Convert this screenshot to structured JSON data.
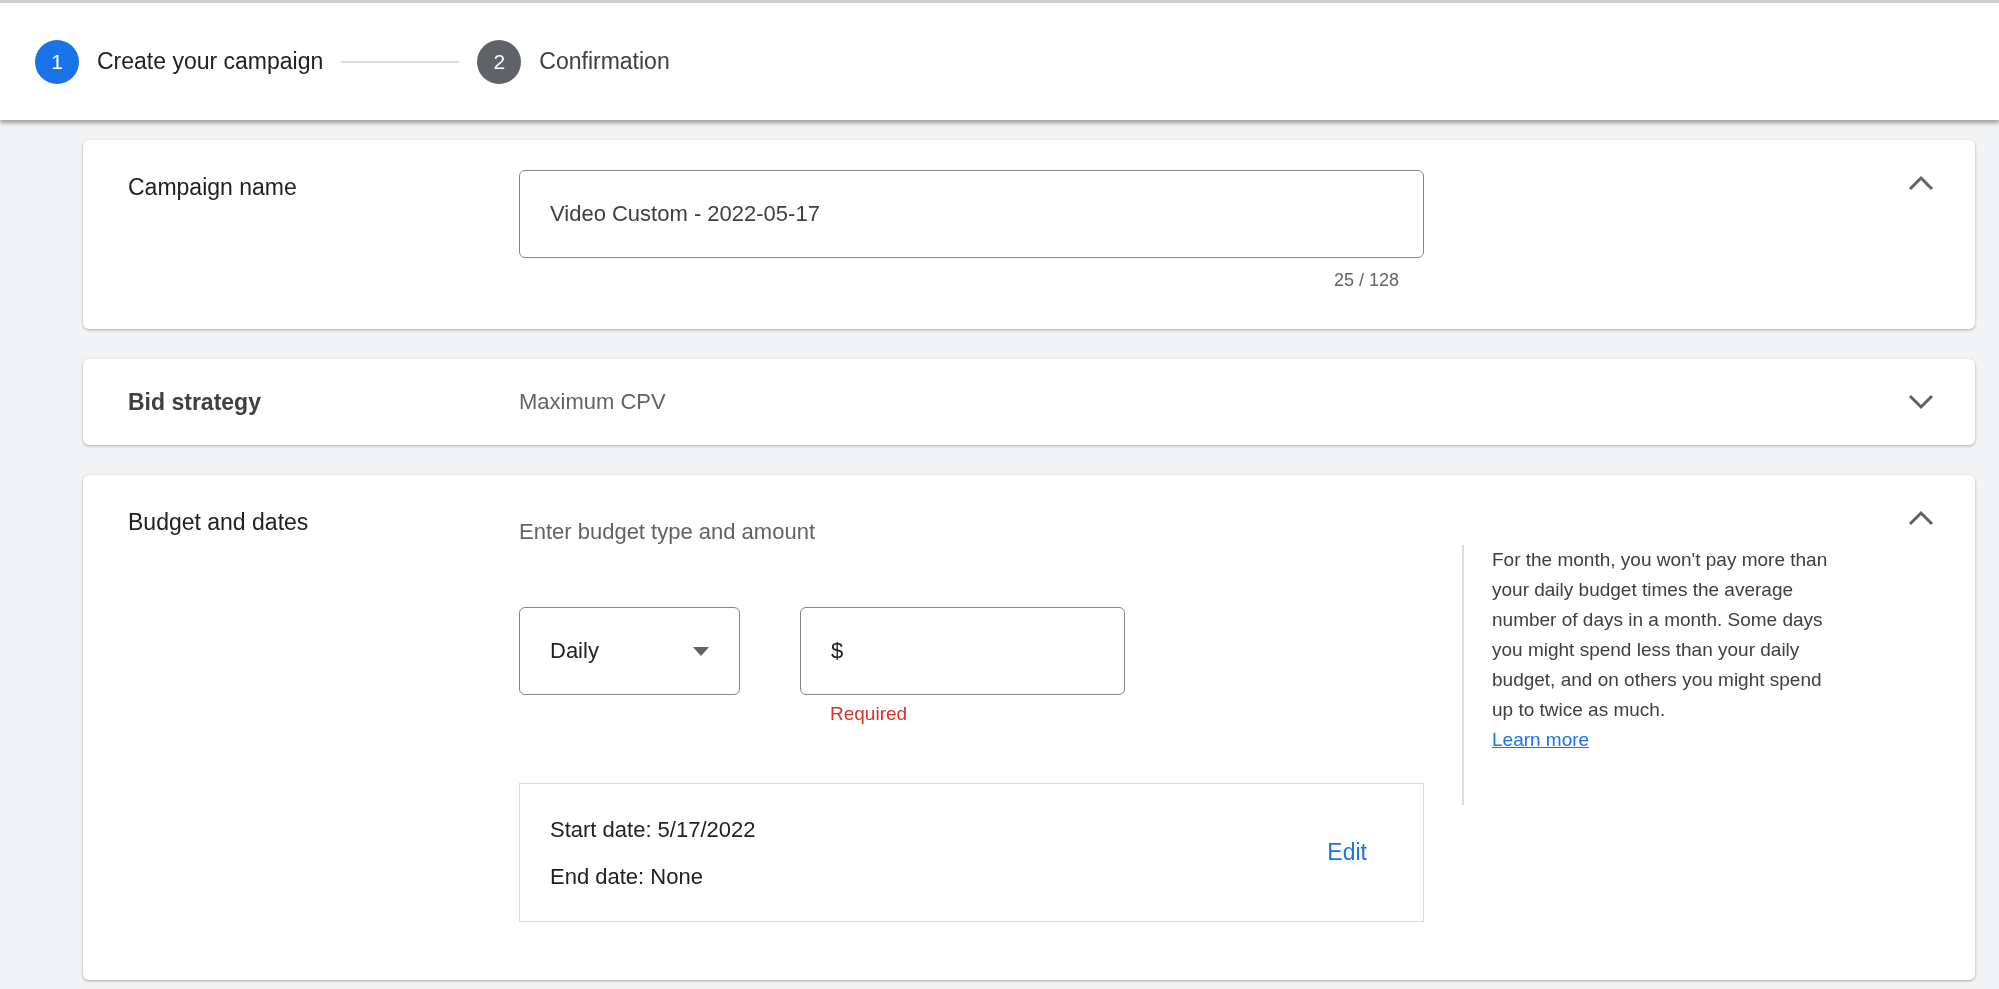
{
  "stepper": {
    "steps": [
      {
        "number": "1",
        "label": "Create your campaign",
        "active": true
      },
      {
        "number": "2",
        "label": "Confirmation",
        "active": false
      }
    ]
  },
  "sections": [
    {
      "kind": "text_field",
      "title": "Campaign name",
      "expanded": true,
      "field": {
        "value": "Video Custom - 2022-05-17",
        "counter": "25 / 128"
      }
    },
    {
      "kind": "summary",
      "title": "Bid strategy",
      "expanded": false,
      "summary": "Maximum CPV"
    },
    {
      "kind": "budget",
      "title": "Budget and dates",
      "expanded": true,
      "prompt": "Enter budget type and amount",
      "budget_type": {
        "value": "Daily"
      },
      "amount": {
        "prefix": "$",
        "error": "Required"
      },
      "dates": {
        "lines": [
          "Start date: 5/17/2022",
          "End date: None"
        ],
        "action": "Edit"
      },
      "help": {
        "text": "For the month, you won't pay more than your daily budget times the average number of days in a month. Some days you might spend less than your daily budget, and on others you might spend up to twice as much.",
        "link": "Learn more"
      }
    }
  ]
}
